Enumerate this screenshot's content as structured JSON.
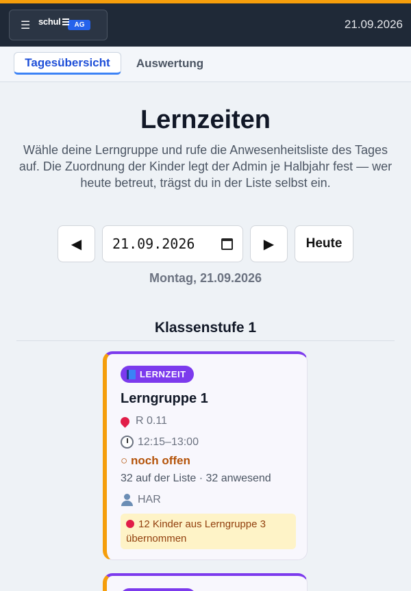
{
  "header": {
    "menu_icon": "hamburger-icon",
    "logo_text": "schul",
    "logo_badge": "AG",
    "date": "21.09.2026"
  },
  "tabs": [
    {
      "label": "Tagesübersicht",
      "active": true
    },
    {
      "label": "Auswertung",
      "active": false
    }
  ],
  "main": {
    "title": "Lernzeiten",
    "intro": "Wähle deine Lerngruppe und rufe die Anwesenheitsliste des Tages auf. Die Zuordnung der Kinder legt der Admin je Halbjahr fest — wer heute betreut, trägst du in der Liste selbst ein."
  },
  "date_nav": {
    "prev_icon": "arrow-left-icon",
    "next_icon": "arrow-right-icon",
    "date_value": "21.09.2026",
    "today_label": "Heute",
    "weekday_label": "Montag, 21.09.2026"
  },
  "section": {
    "title": "Klassenstufe 1"
  },
  "cards": [
    {
      "badge": "LERNZEIT",
      "title": "Lerngruppe 1",
      "room": "R 0.11",
      "time": "12:15–13:00",
      "status": "○ noch offen",
      "count": "32 auf der Liste · 32 anwesend",
      "teacher": "HAR",
      "note": "12 Kinder aus Lerngruppe 3 übernommen"
    }
  ],
  "colors": {
    "accent": "#f59e0b",
    "brand": "#2563eb",
    "badge": "#7c3aed",
    "status_open": "#b45309"
  }
}
